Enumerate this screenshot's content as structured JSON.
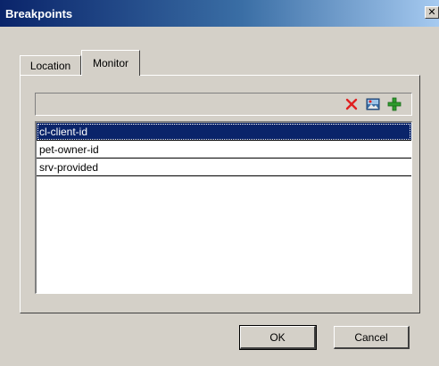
{
  "window": {
    "title": "Breakpoints",
    "close_glyph": "✕"
  },
  "tabs": [
    {
      "label": "Location",
      "selected": false
    },
    {
      "label": "Monitor",
      "selected": true
    }
  ],
  "toolbar": {
    "icons": [
      "delete-icon",
      "image-icon",
      "add-icon"
    ],
    "colors": {
      "delete": "#e02020",
      "add": "#2e9b2e"
    }
  },
  "list": {
    "items": [
      {
        "label": "cl-client-id",
        "selected": true
      },
      {
        "label": "pet-owner-id",
        "selected": false
      },
      {
        "label": "srv-provided",
        "selected": false
      }
    ]
  },
  "buttons": {
    "ok_label": "OK",
    "cancel_label": "Cancel"
  }
}
